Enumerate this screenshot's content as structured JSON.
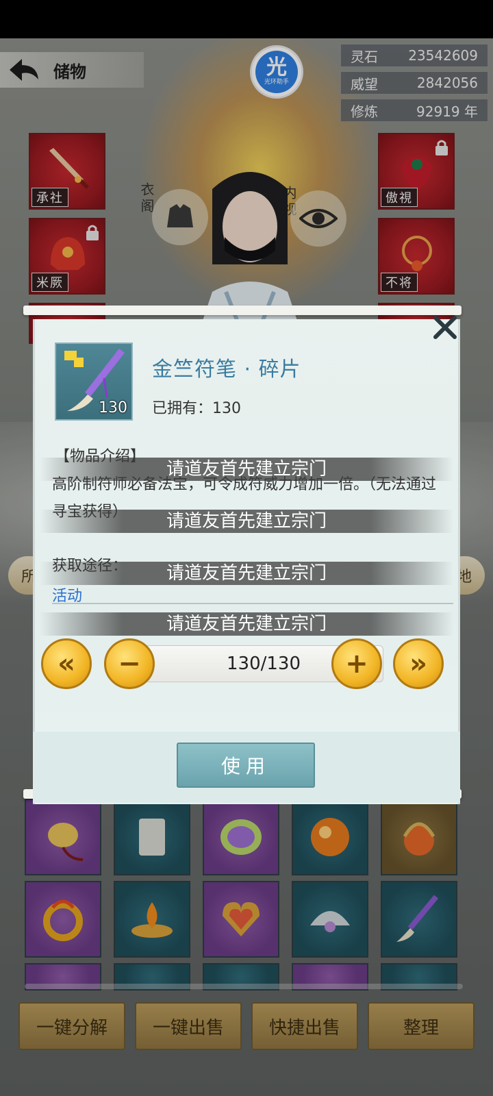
{
  "header": {
    "title": "储物",
    "helper_logo_glyph": "光",
    "helper_logo_text": "光环助手"
  },
  "stats": [
    {
      "label": "灵石",
      "value": "23542609"
    },
    {
      "label": "威望",
      "value": "2842056"
    },
    {
      "label": "修炼",
      "value": "92919 年"
    }
  ],
  "equipment": {
    "left_top_seal": "承社",
    "left_mid_seal": "米厥",
    "right_top_seal": "傲視",
    "right_mid_seal": "不将"
  },
  "character_buttons": {
    "wardrobe_label": "衣阁",
    "inspect_label": "内视"
  },
  "side_pills": {
    "left": "所",
    "right": "地"
  },
  "modal": {
    "item_name": "金竺符笔 · 碎片",
    "item_count": "130",
    "owned_text": "已拥有：130",
    "section_title": "【物品介绍】",
    "description": "高阶制符师必备法宝，可令成符威力增加一倍。（无法通过寻宝获得）",
    "acquire_label": "获取途径：",
    "acquire_link": "活动",
    "quantity_display": "130/130",
    "min_label": "«",
    "minus_label": "−",
    "plus_label": "+",
    "max_label": "»",
    "use_button": "使用"
  },
  "toast_message": "请道友首先建立宗门",
  "bottom_buttons": [
    "一键分解",
    "一键出售",
    "快捷出售",
    "整理"
  ]
}
